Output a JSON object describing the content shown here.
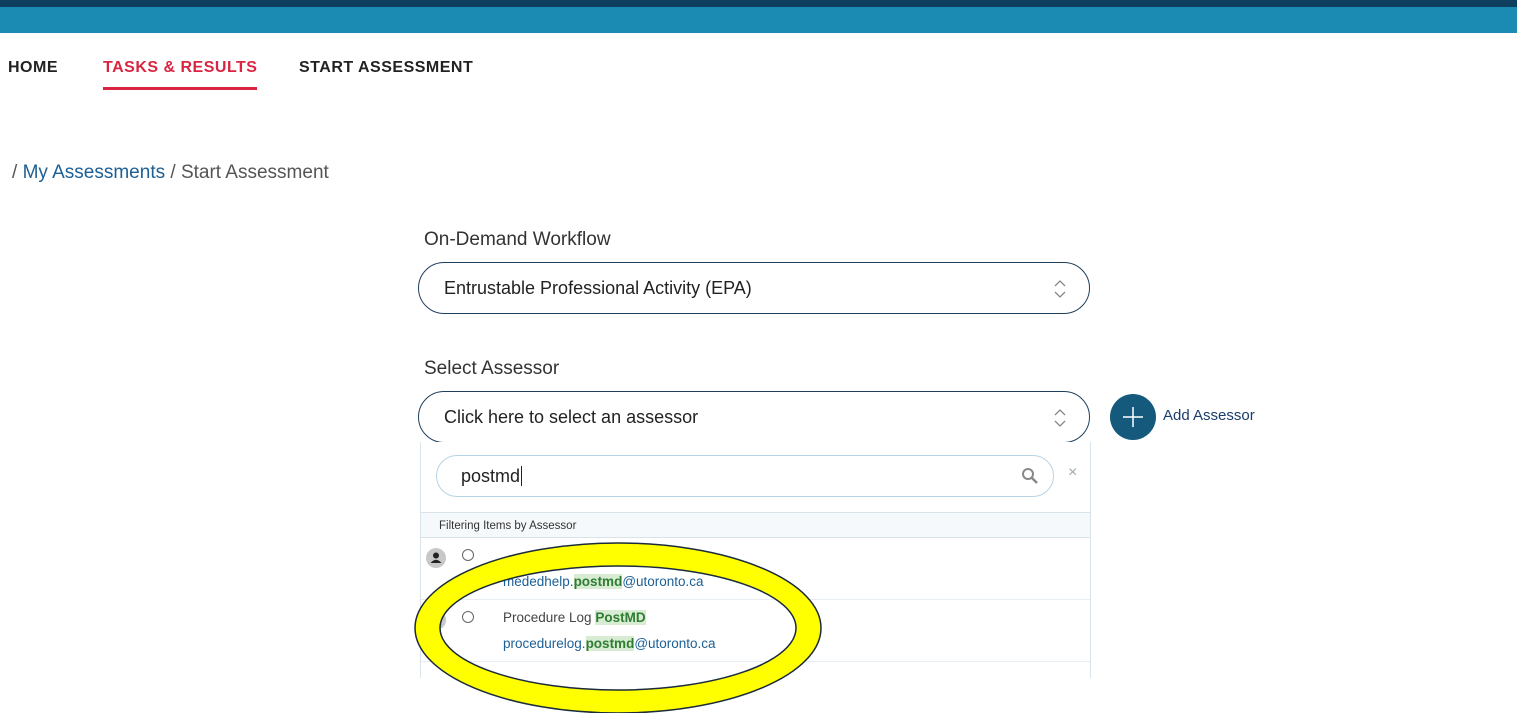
{
  "nav": {
    "home": "HOME",
    "tasks": "TASKS & RESULTS",
    "start": "START ASSESSMENT"
  },
  "breadcrumb": {
    "sep1": "/",
    "link": "My Assessments",
    "sep2": "/",
    "current": "Start Assessment"
  },
  "workflow": {
    "label": "On-Demand Workflow",
    "value": "Entrustable Professional Activity (EPA)"
  },
  "assessor": {
    "label": "Select Assessor",
    "placeholder": "Click here to select an assessor",
    "add_label": "Add Assessor"
  },
  "dropdown": {
    "search_value": "postmd",
    "clear": "×",
    "filter_header": "Filtering Items by Assessor",
    "results": [
      {
        "name_prefix": "",
        "name_highlight": "",
        "email_prefix": "mededhelp.",
        "email_highlight": "postmd",
        "email_suffix": "@utoronto.ca"
      },
      {
        "name_prefix": "Procedure Log ",
        "name_highlight": "PostMD",
        "email_prefix": "procedurelog.",
        "email_highlight": "postmd",
        "email_suffix": "@utoronto.ca"
      }
    ]
  },
  "colors": {
    "accent": "#d92541",
    "topbar": "#1c8bb4",
    "button": "#155a7c",
    "annotation": "#ffff00"
  }
}
